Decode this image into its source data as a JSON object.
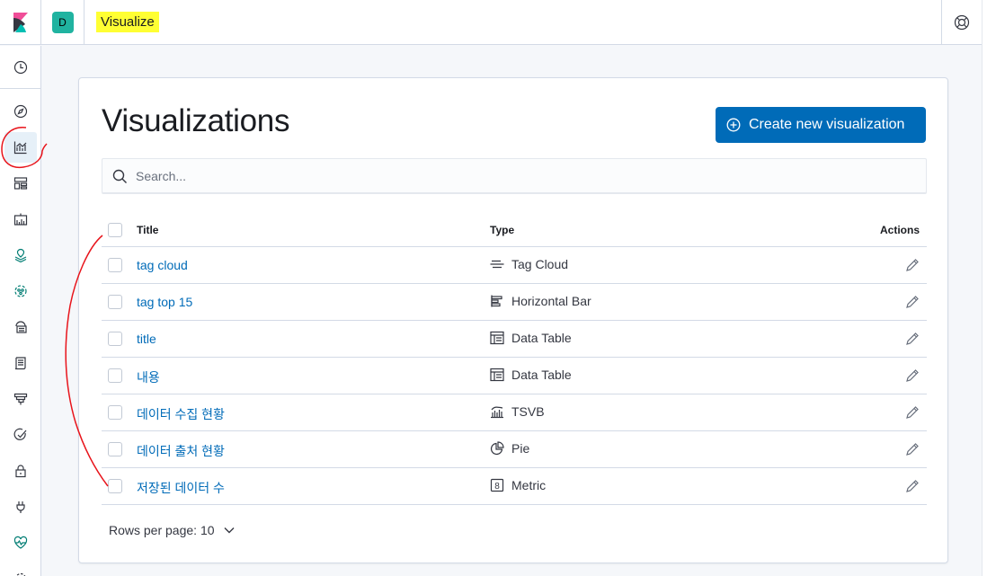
{
  "header": {
    "space_initial": "D",
    "breadcrumb": "Visualize",
    "highlight_color": "#ffff33"
  },
  "sidenav": {
    "items": [
      {
        "icon": "clock-icon",
        "label": "Recently viewed"
      },
      {
        "icon": "compass-icon",
        "label": "Discover"
      },
      {
        "icon": "visualize-icon",
        "label": "Visualize",
        "active": true
      },
      {
        "icon": "dashboard-icon",
        "label": "Dashboard"
      },
      {
        "icon": "canvas-icon",
        "label": "Canvas"
      },
      {
        "icon": "maps-icon",
        "label": "Maps"
      },
      {
        "icon": "ml-icon",
        "label": "Machine Learning"
      },
      {
        "icon": "infra-icon",
        "label": "Infrastructure"
      },
      {
        "icon": "logs-icon",
        "label": "Logs"
      },
      {
        "icon": "apm-icon",
        "label": "APM"
      },
      {
        "icon": "uptime-icon",
        "label": "Uptime"
      },
      {
        "icon": "siem-icon",
        "label": "SIEM"
      },
      {
        "icon": "devtools-icon",
        "label": "Dev Tools"
      },
      {
        "icon": "monitoring-icon",
        "label": "Stack Monitoring"
      },
      {
        "icon": "management-icon",
        "label": "Management"
      }
    ]
  },
  "main": {
    "title": "Visualizations",
    "create_button": "Create new visualization",
    "search_placeholder": "Search...",
    "columns": {
      "title": "Title",
      "type": "Type",
      "actions": "Actions"
    },
    "rows": [
      {
        "title": "tag cloud",
        "type": "Tag Cloud",
        "type_icon": "tagcloud-icon"
      },
      {
        "title": "tag top 15",
        "type": "Horizontal Bar",
        "type_icon": "horizontal-bar-icon"
      },
      {
        "title": "title",
        "type": "Data Table",
        "type_icon": "data-table-icon"
      },
      {
        "title": "내용",
        "type": "Data Table",
        "type_icon": "data-table-icon"
      },
      {
        "title": "데이터 수집 현황",
        "type": "TSVB",
        "type_icon": "tsvb-icon"
      },
      {
        "title": "데이터 출처 현황",
        "type": "Pie",
        "type_icon": "pie-icon"
      },
      {
        "title": "저장된 데이터 수",
        "type": "Metric",
        "type_icon": "metric-icon"
      }
    ],
    "rows_per_page": "Rows per page: 10"
  },
  "colors": {
    "accent": "#006bb8",
    "link": "#006bb8",
    "annotation": "#e8141b",
    "space_avatar": "#20b3a0"
  }
}
